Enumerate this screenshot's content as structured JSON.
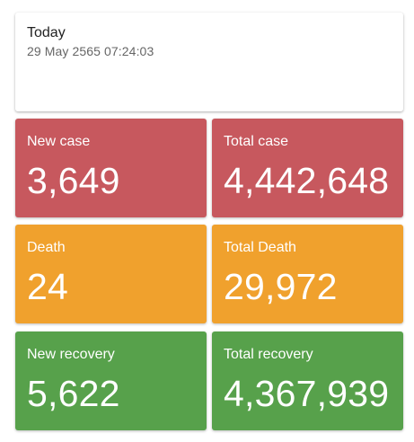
{
  "header": {
    "title": "Today",
    "datetime": "29 May 2565 07:24:03"
  },
  "tiles": [
    {
      "label": "New case",
      "value": "3,649",
      "color": "#c7585e"
    },
    {
      "label": "Total case",
      "value": "4,442,648",
      "color": "#c7585e"
    },
    {
      "label": "Death",
      "value": "24",
      "color": "#f0a12d"
    },
    {
      "label": "Total Death",
      "value": "29,972",
      "color": "#f0a12d"
    },
    {
      "label": "New recovery",
      "value": "5,622",
      "color": "#57a14b"
    },
    {
      "label": "Total recovery",
      "value": "4,367,939",
      "color": "#57a14b"
    }
  ]
}
